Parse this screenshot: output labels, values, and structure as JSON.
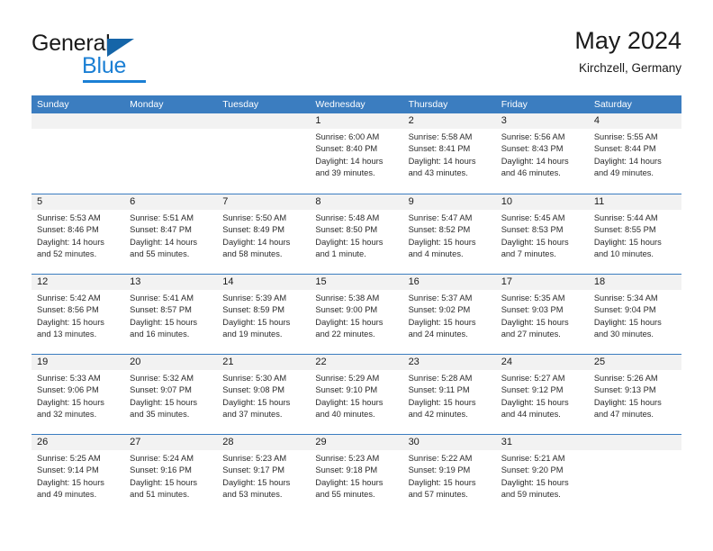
{
  "brand": {
    "name_part1": "General",
    "name_part2": "Blue",
    "logo_icon": "triangle-icon"
  },
  "header": {
    "title": "May 2024",
    "location": "Kirchzell, Germany"
  },
  "colors": {
    "header_blue": "#3b7dc0",
    "brand_blue": "#1b7fd4",
    "day_number_bg": "#f2f2f2",
    "text": "#1a1a1a"
  },
  "weekdays": [
    "Sunday",
    "Monday",
    "Tuesday",
    "Wednesday",
    "Thursday",
    "Friday",
    "Saturday"
  ],
  "weeks": [
    [
      {
        "empty": true
      },
      {
        "empty": true
      },
      {
        "empty": true
      },
      {
        "day": "1",
        "sunrise": "Sunrise: 6:00 AM",
        "sunset": "Sunset: 8:40 PM",
        "daylight": "Daylight: 14 hours and 39 minutes."
      },
      {
        "day": "2",
        "sunrise": "Sunrise: 5:58 AM",
        "sunset": "Sunset: 8:41 PM",
        "daylight": "Daylight: 14 hours and 43 minutes."
      },
      {
        "day": "3",
        "sunrise": "Sunrise: 5:56 AM",
        "sunset": "Sunset: 8:43 PM",
        "daylight": "Daylight: 14 hours and 46 minutes."
      },
      {
        "day": "4",
        "sunrise": "Sunrise: 5:55 AM",
        "sunset": "Sunset: 8:44 PM",
        "daylight": "Daylight: 14 hours and 49 minutes."
      }
    ],
    [
      {
        "day": "5",
        "sunrise": "Sunrise: 5:53 AM",
        "sunset": "Sunset: 8:46 PM",
        "daylight": "Daylight: 14 hours and 52 minutes."
      },
      {
        "day": "6",
        "sunrise": "Sunrise: 5:51 AM",
        "sunset": "Sunset: 8:47 PM",
        "daylight": "Daylight: 14 hours and 55 minutes."
      },
      {
        "day": "7",
        "sunrise": "Sunrise: 5:50 AM",
        "sunset": "Sunset: 8:49 PM",
        "daylight": "Daylight: 14 hours and 58 minutes."
      },
      {
        "day": "8",
        "sunrise": "Sunrise: 5:48 AM",
        "sunset": "Sunset: 8:50 PM",
        "daylight": "Daylight: 15 hours and 1 minute."
      },
      {
        "day": "9",
        "sunrise": "Sunrise: 5:47 AM",
        "sunset": "Sunset: 8:52 PM",
        "daylight": "Daylight: 15 hours and 4 minutes."
      },
      {
        "day": "10",
        "sunrise": "Sunrise: 5:45 AM",
        "sunset": "Sunset: 8:53 PM",
        "daylight": "Daylight: 15 hours and 7 minutes."
      },
      {
        "day": "11",
        "sunrise": "Sunrise: 5:44 AM",
        "sunset": "Sunset: 8:55 PM",
        "daylight": "Daylight: 15 hours and 10 minutes."
      }
    ],
    [
      {
        "day": "12",
        "sunrise": "Sunrise: 5:42 AM",
        "sunset": "Sunset: 8:56 PM",
        "daylight": "Daylight: 15 hours and 13 minutes."
      },
      {
        "day": "13",
        "sunrise": "Sunrise: 5:41 AM",
        "sunset": "Sunset: 8:57 PM",
        "daylight": "Daylight: 15 hours and 16 minutes."
      },
      {
        "day": "14",
        "sunrise": "Sunrise: 5:39 AM",
        "sunset": "Sunset: 8:59 PM",
        "daylight": "Daylight: 15 hours and 19 minutes."
      },
      {
        "day": "15",
        "sunrise": "Sunrise: 5:38 AM",
        "sunset": "Sunset: 9:00 PM",
        "daylight": "Daylight: 15 hours and 22 minutes."
      },
      {
        "day": "16",
        "sunrise": "Sunrise: 5:37 AM",
        "sunset": "Sunset: 9:02 PM",
        "daylight": "Daylight: 15 hours and 24 minutes."
      },
      {
        "day": "17",
        "sunrise": "Sunrise: 5:35 AM",
        "sunset": "Sunset: 9:03 PM",
        "daylight": "Daylight: 15 hours and 27 minutes."
      },
      {
        "day": "18",
        "sunrise": "Sunrise: 5:34 AM",
        "sunset": "Sunset: 9:04 PM",
        "daylight": "Daylight: 15 hours and 30 minutes."
      }
    ],
    [
      {
        "day": "19",
        "sunrise": "Sunrise: 5:33 AM",
        "sunset": "Sunset: 9:06 PM",
        "daylight": "Daylight: 15 hours and 32 minutes."
      },
      {
        "day": "20",
        "sunrise": "Sunrise: 5:32 AM",
        "sunset": "Sunset: 9:07 PM",
        "daylight": "Daylight: 15 hours and 35 minutes."
      },
      {
        "day": "21",
        "sunrise": "Sunrise: 5:30 AM",
        "sunset": "Sunset: 9:08 PM",
        "daylight": "Daylight: 15 hours and 37 minutes."
      },
      {
        "day": "22",
        "sunrise": "Sunrise: 5:29 AM",
        "sunset": "Sunset: 9:10 PM",
        "daylight": "Daylight: 15 hours and 40 minutes."
      },
      {
        "day": "23",
        "sunrise": "Sunrise: 5:28 AM",
        "sunset": "Sunset: 9:11 PM",
        "daylight": "Daylight: 15 hours and 42 minutes."
      },
      {
        "day": "24",
        "sunrise": "Sunrise: 5:27 AM",
        "sunset": "Sunset: 9:12 PM",
        "daylight": "Daylight: 15 hours and 44 minutes."
      },
      {
        "day": "25",
        "sunrise": "Sunrise: 5:26 AM",
        "sunset": "Sunset: 9:13 PM",
        "daylight": "Daylight: 15 hours and 47 minutes."
      }
    ],
    [
      {
        "day": "26",
        "sunrise": "Sunrise: 5:25 AM",
        "sunset": "Sunset: 9:14 PM",
        "daylight": "Daylight: 15 hours and 49 minutes."
      },
      {
        "day": "27",
        "sunrise": "Sunrise: 5:24 AM",
        "sunset": "Sunset: 9:16 PM",
        "daylight": "Daylight: 15 hours and 51 minutes."
      },
      {
        "day": "28",
        "sunrise": "Sunrise: 5:23 AM",
        "sunset": "Sunset: 9:17 PM",
        "daylight": "Daylight: 15 hours and 53 minutes."
      },
      {
        "day": "29",
        "sunrise": "Sunrise: 5:23 AM",
        "sunset": "Sunset: 9:18 PM",
        "daylight": "Daylight: 15 hours and 55 minutes."
      },
      {
        "day": "30",
        "sunrise": "Sunrise: 5:22 AM",
        "sunset": "Sunset: 9:19 PM",
        "daylight": "Daylight: 15 hours and 57 minutes."
      },
      {
        "day": "31",
        "sunrise": "Sunrise: 5:21 AM",
        "sunset": "Sunset: 9:20 PM",
        "daylight": "Daylight: 15 hours and 59 minutes."
      },
      {
        "empty": true
      }
    ]
  ]
}
